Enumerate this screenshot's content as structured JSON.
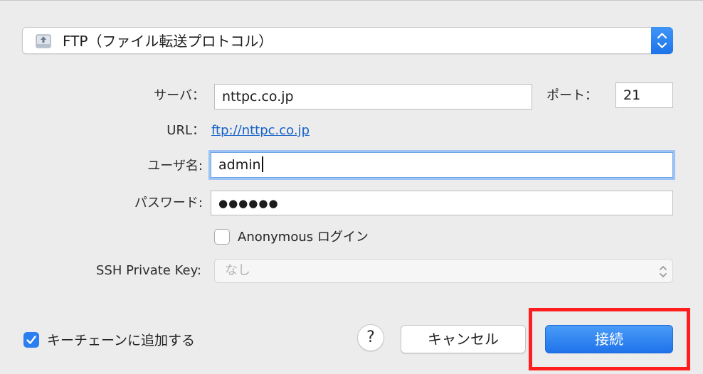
{
  "protocol": {
    "selected": "FTP（ファイル転送プロトコル）",
    "icon": "network-drive-icon"
  },
  "server": {
    "label": "サーバ：",
    "value": "nttpc.co.jp"
  },
  "port": {
    "label": "ポート：",
    "value": "21"
  },
  "url": {
    "label": "URL：",
    "value": "ftp://nttpc.co.jp"
  },
  "username": {
    "label": "ユーザ名:",
    "value": "admin"
  },
  "password": {
    "label": "パスワード:",
    "value": "●●●●●●"
  },
  "anonymous": {
    "label": "Anonymous ログイン",
    "checked": false
  },
  "ssh_key": {
    "label": "SSH Private Key:",
    "placeholder": "なし"
  },
  "keychain": {
    "label": "キーチェーンに追加する",
    "checked": true
  },
  "buttons": {
    "help": "?",
    "cancel": "キャンセル",
    "connect": "接続"
  },
  "colors": {
    "accent": "#2c7ff0",
    "highlight": "#ff1d1d",
    "link": "#1662c8"
  }
}
